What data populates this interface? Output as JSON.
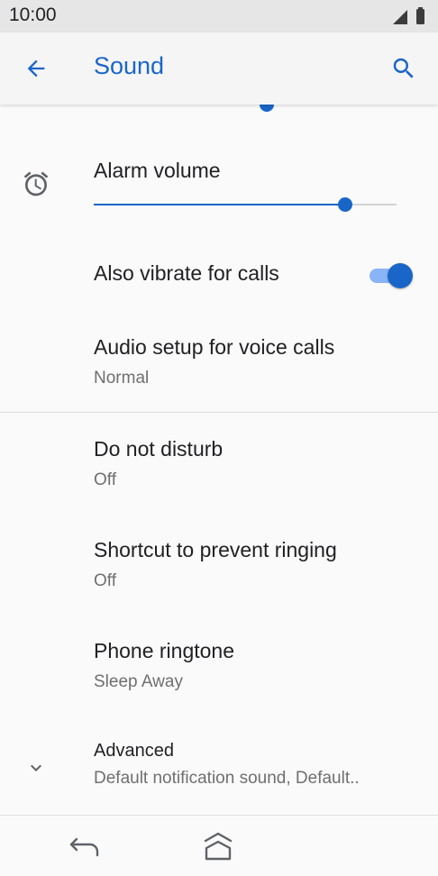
{
  "status_bar": {
    "time": "10:00",
    "icons": [
      "cellular-signal-icon",
      "battery-icon"
    ]
  },
  "app_bar": {
    "title": "Sound",
    "back_icon": "arrow-back-icon",
    "search_icon": "search-icon"
  },
  "settings": {
    "alarm_volume": {
      "label": "Alarm volume",
      "icon": "alarm-clock-icon",
      "level_percent": 83
    },
    "vibrate_for_calls": {
      "label": "Also vibrate for calls",
      "enabled": true
    },
    "audio_setup": {
      "label": "Audio setup for voice calls",
      "value": "Normal"
    },
    "do_not_disturb": {
      "label": "Do not disturb",
      "value": "Off"
    },
    "prevent_ringing": {
      "label": "Shortcut to prevent ringing",
      "value": "Off"
    },
    "phone_ringtone": {
      "label": "Phone ringtone",
      "value": "Sleep Away"
    },
    "advanced": {
      "label": "Advanced",
      "value": "Default notification sound, Default..",
      "icon": "chevron-down-icon"
    }
  },
  "nav_bar": {
    "back_icon": "nav-back-icon",
    "home_icon": "nav-home-icon"
  },
  "colors": {
    "accent": "#1a66c8",
    "accent_light": "#8ab4f8",
    "text_primary": "#202124",
    "text_secondary": "#6f6f6f"
  }
}
